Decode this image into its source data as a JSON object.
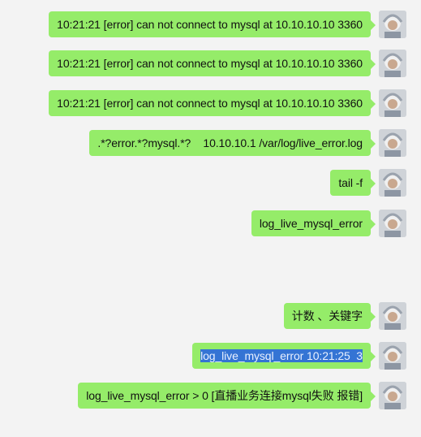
{
  "messages": [
    {
      "text": "10:21:21 [error] can not connect to mysql at 10.10.10.10 3360"
    },
    {
      "text": "10:21:21 [error] can not connect to mysql at 10.10.10.10 3360"
    },
    {
      "text": "10:21:21 [error] can not connect to mysql at 10.10.10.10 3360"
    },
    {
      "text": ".*?error.*?mysql.*?    10.10.10.1 /var/log/live_error.log"
    },
    {
      "text": "tail -f"
    },
    {
      "text": "log_live_mysql_error"
    },
    {
      "text": "计数 、关键字"
    },
    {
      "text": "log_live_mysql_error 10:21:25  3",
      "selected": true
    },
    {
      "text": "log_live_mysql_error > 0 [直播业务连接mysql失败 报错]"
    }
  ],
  "colors": {
    "bubble": "#95ec69",
    "selection": "#3474d4",
    "background": "#f3f3f3"
  },
  "icons": {
    "avatar": "user-avatar"
  }
}
